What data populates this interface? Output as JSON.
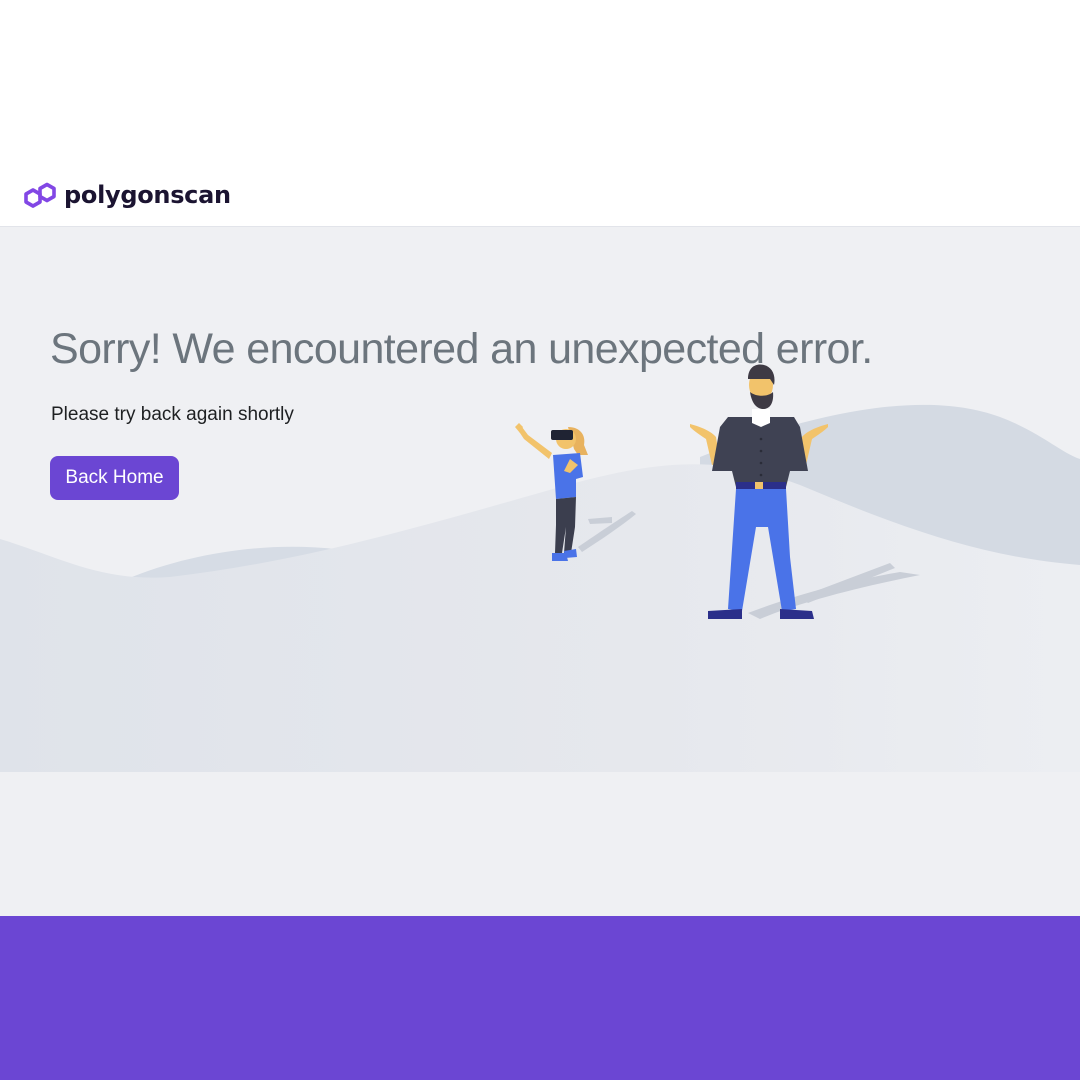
{
  "brand": {
    "name": "polygonscan",
    "accent_color": "#8247e5"
  },
  "error": {
    "title": "Sorry! We encountered an unexpected error.",
    "message": "Please try back again shortly",
    "button_label": "Back Home",
    "button_color": "#6b46d3"
  },
  "illustration": {
    "figures": [
      "woman-with-vr-headset",
      "man-shrugging"
    ]
  },
  "footer": {
    "color": "#6b46d3"
  }
}
